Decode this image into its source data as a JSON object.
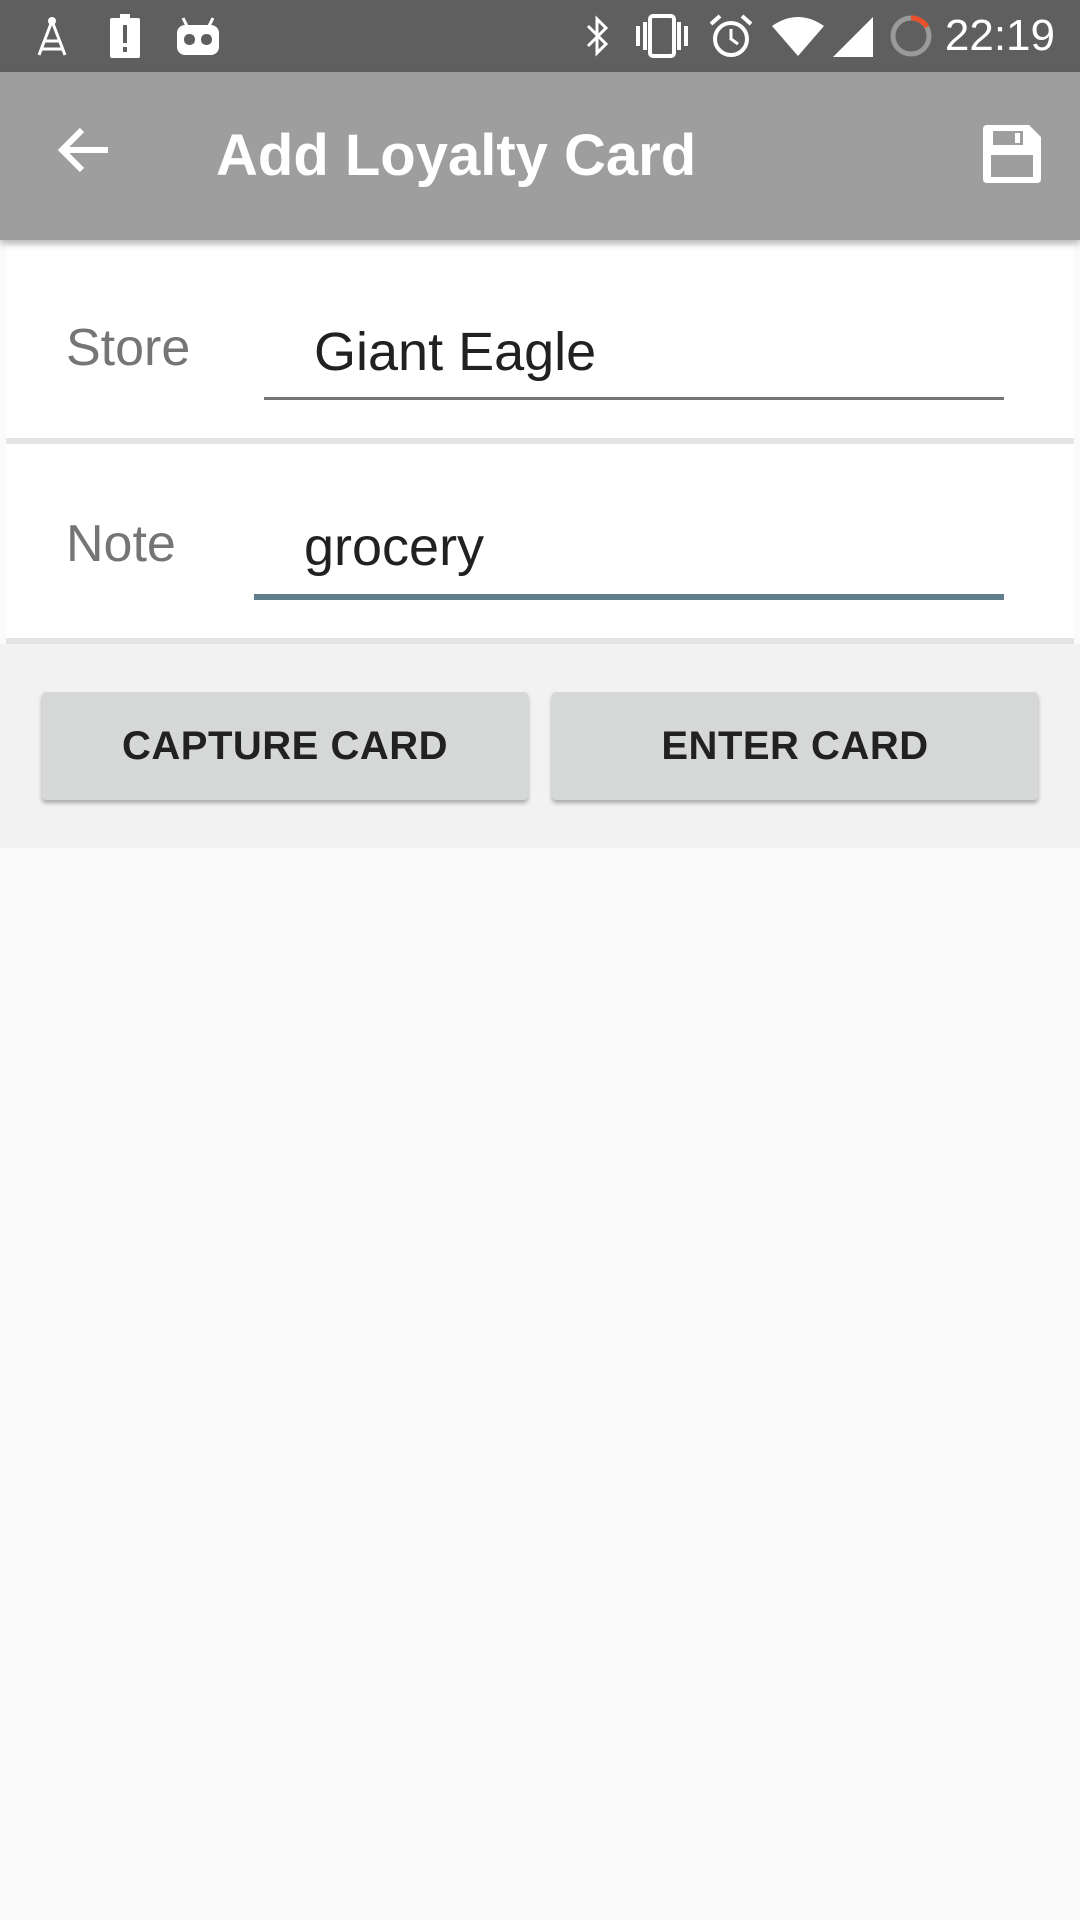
{
  "status_bar": {
    "time": "22:19",
    "icons": [
      "signal-tower-icon",
      "battery-alert-icon",
      "android-icon",
      "bluetooth-icon",
      "vibrate-icon",
      "alarm-icon",
      "wifi-icon",
      "cell-signal-icon",
      "loading-spinner-icon"
    ]
  },
  "app_bar": {
    "title": "Add Loyalty Card",
    "back_icon": "arrow-back-icon",
    "save_icon": "floppy-disk-icon"
  },
  "form": {
    "store": {
      "label": "Store",
      "value": "Giant Eagle"
    },
    "note": {
      "label": "Note",
      "value": "grocery"
    }
  },
  "actions": {
    "capture_label": "CAPTURE CARD",
    "enter_label": "ENTER CARD"
  },
  "colors": {
    "app_bar": "#9e9e9e",
    "status_bar": "#5f5f5f",
    "focus_underline": "#607d8b",
    "spinner_accent": "#e8502c"
  }
}
